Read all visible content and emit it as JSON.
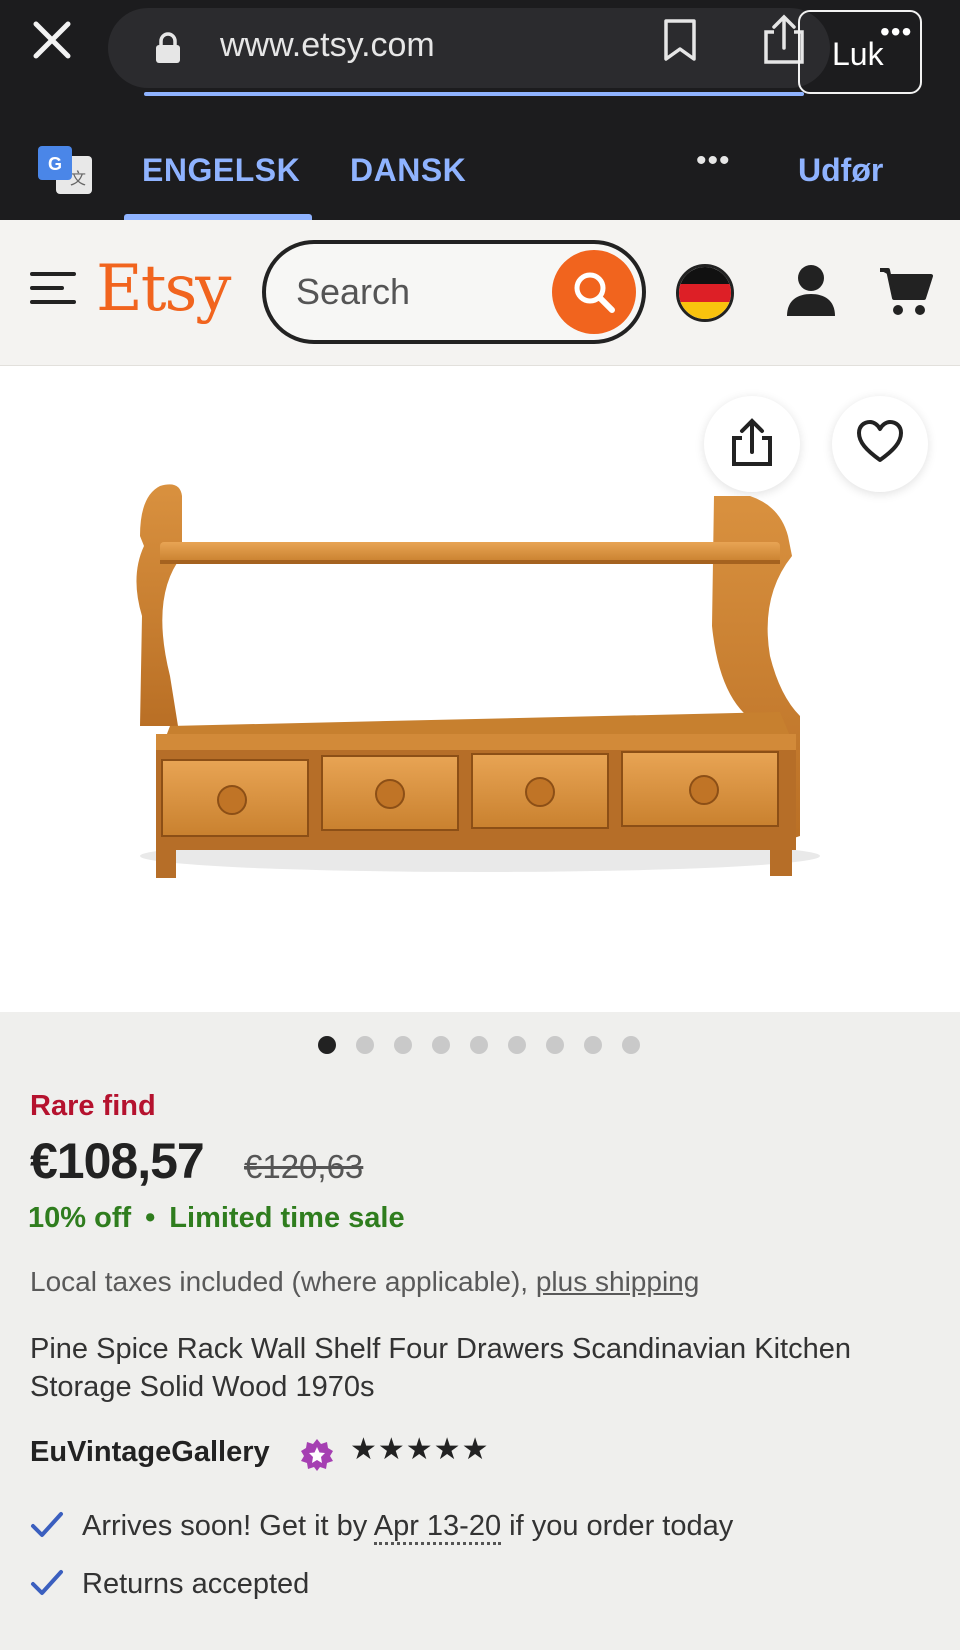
{
  "browser": {
    "url": "www.etsy.com",
    "close_label": "Luk",
    "more_label": "•••"
  },
  "translate": {
    "tab_source": "ENGELSK",
    "tab_target": "DANSK",
    "more_label": "•••",
    "action_label": "Udfør"
  },
  "header": {
    "logo": "Etsy",
    "search_placeholder": "Search",
    "flag_icon": "germany-flag-icon",
    "accent_color": "#f1641e"
  },
  "gallery": {
    "image_count": 9,
    "active_index": 0
  },
  "product": {
    "badge": "Rare find",
    "price": "€108,57",
    "original_price": "€120,63",
    "discount": "10% off",
    "separator": "•",
    "sale_label": "Limited time sale",
    "taxes_text": "Local taxes included (where applicable), ",
    "shipping_link": "plus shipping",
    "title": "Pine Spice Rack Wall Shelf Four Drawers Scandinavian Kitchen Storage Solid Wood 1970s",
    "shop_name": "EuVintageGallery",
    "rating_stars": "★★★★★",
    "delivery_prefix": "Arrives soon! Get it by ",
    "delivery_dates": "Apr 13-20",
    "delivery_suffix": " if you order today",
    "returns": "Returns accepted"
  }
}
